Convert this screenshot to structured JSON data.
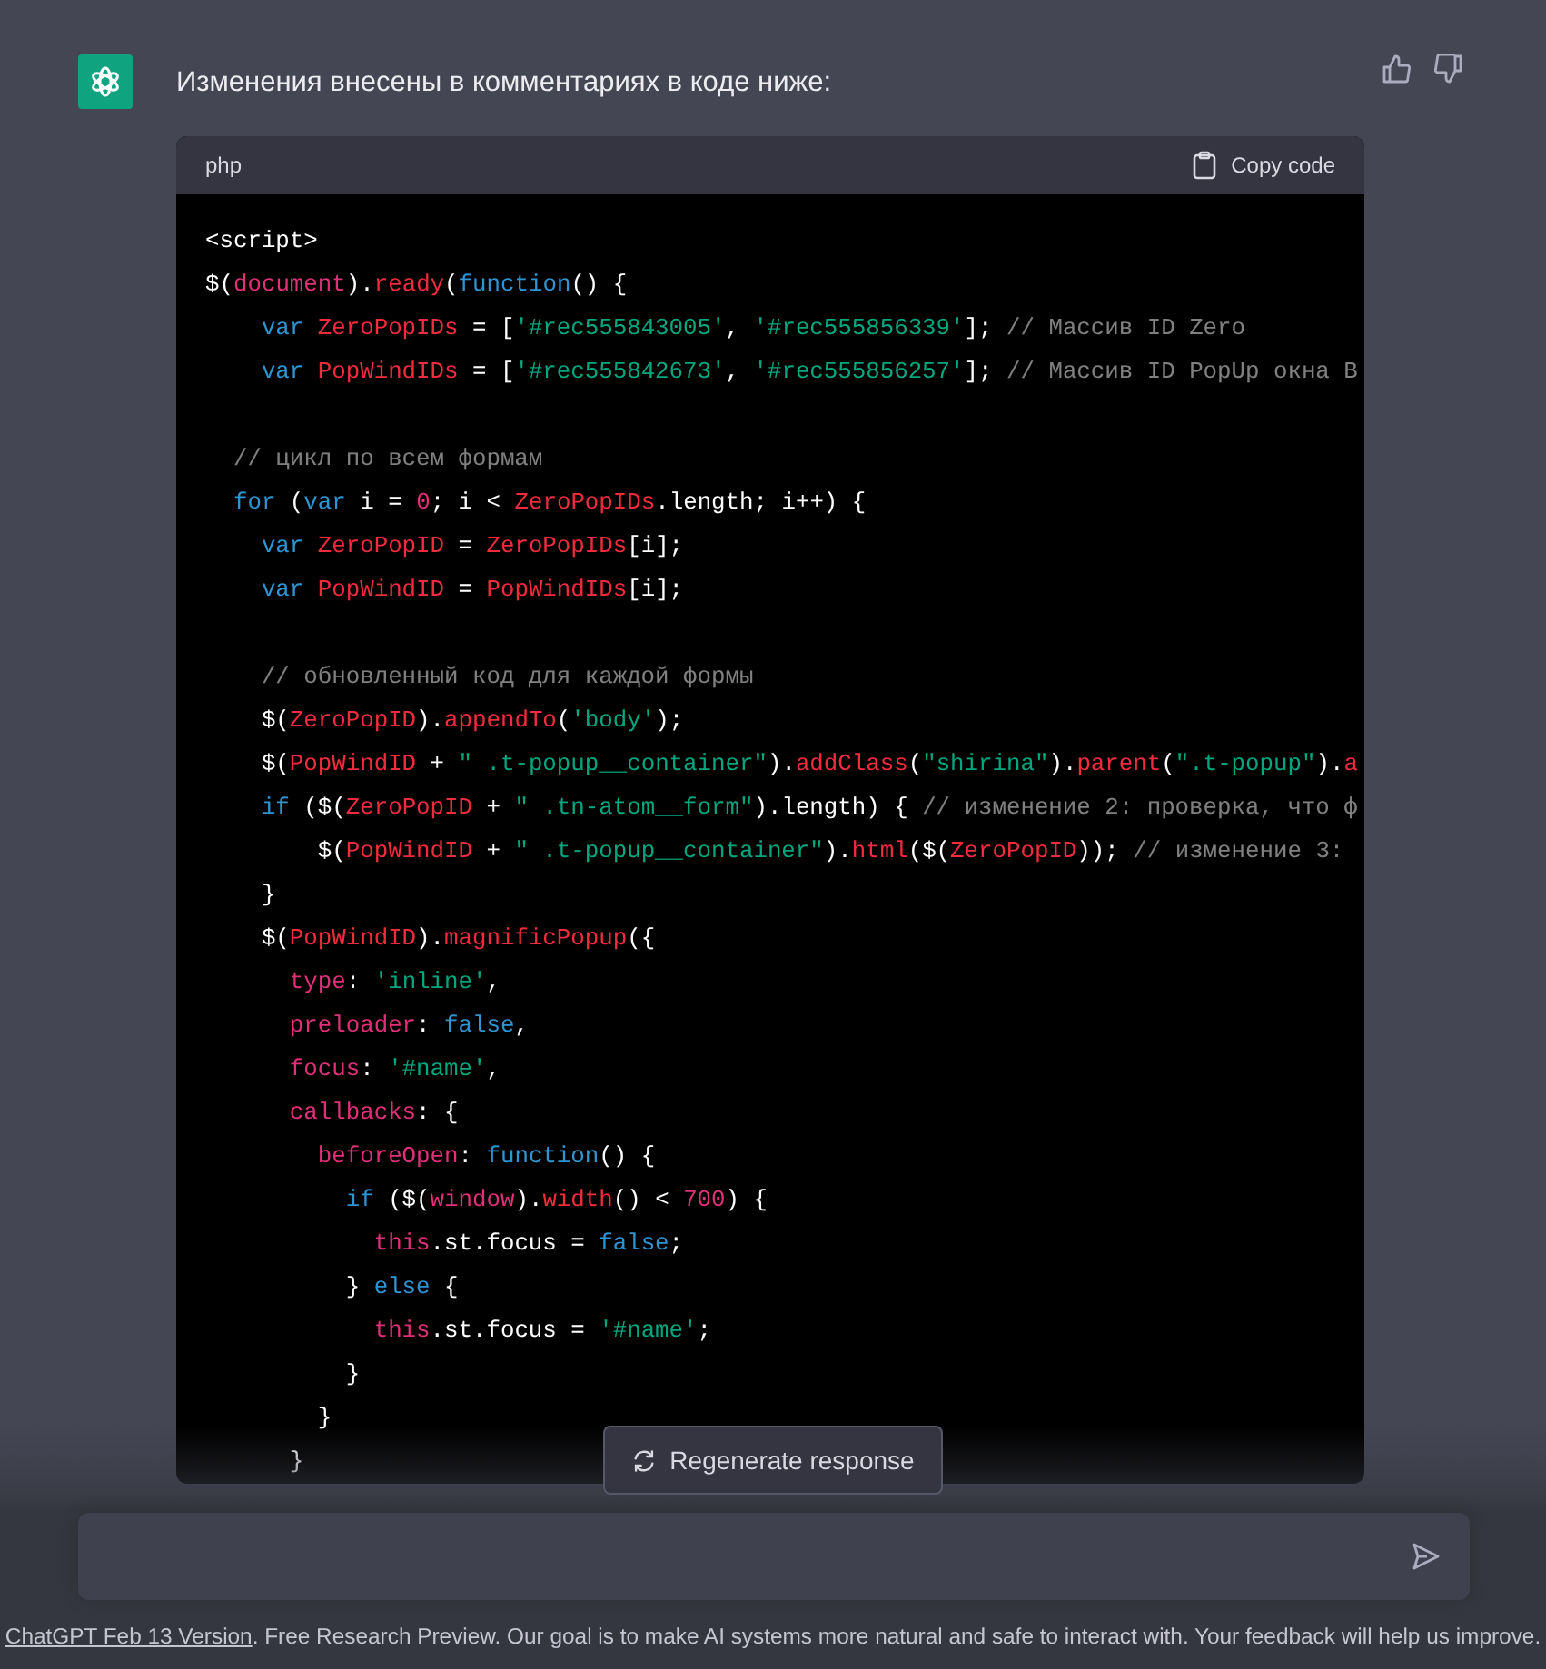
{
  "message": {
    "text": "Изменения внесены в комментариях в коде ниже:"
  },
  "code_block": {
    "language": "php",
    "copy_label": "Copy code",
    "lines": [
      {
        "kind": "code",
        "tokens": [
          {
            "kind": "plain",
            "text": "<script>"
          }
        ]
      },
      {
        "kind": "code",
        "tokens": [
          {
            "kind": "plain",
            "text": "$("
          },
          {
            "kind": "prop",
            "text": "document"
          },
          {
            "kind": "plain",
            "text": ")."
          },
          {
            "kind": "name",
            "text": "ready"
          },
          {
            "kind": "plain",
            "text": "("
          },
          {
            "kind": "keyword",
            "text": "function"
          },
          {
            "kind": "plain",
            "text": "() {"
          }
        ]
      },
      {
        "kind": "code",
        "tokens": [
          {
            "kind": "keyword",
            "text": "    var "
          },
          {
            "kind": "name",
            "text": "ZeroPopIDs"
          },
          {
            "kind": "plain",
            "text": " = ["
          },
          {
            "kind": "string",
            "text": "'#rec555843005'"
          },
          {
            "kind": "plain",
            "text": ", "
          },
          {
            "kind": "string",
            "text": "'#rec555856339'"
          },
          {
            "kind": "plain",
            "text": "]; "
          },
          {
            "kind": "comment",
            "text": "// Массив ID Zero"
          }
        ]
      },
      {
        "kind": "code",
        "tokens": [
          {
            "kind": "keyword",
            "text": "    var "
          },
          {
            "kind": "name",
            "text": "PopWindIDs"
          },
          {
            "kind": "plain",
            "text": " = ["
          },
          {
            "kind": "string",
            "text": "'#rec555842673'"
          },
          {
            "kind": "plain",
            "text": ", "
          },
          {
            "kind": "string",
            "text": "'#rec555856257'"
          },
          {
            "kind": "plain",
            "text": "]; "
          },
          {
            "kind": "comment",
            "text": "// Массив ID PopUp окна B"
          }
        ]
      },
      {
        "kind": "blank"
      },
      {
        "kind": "code",
        "tokens": [
          {
            "kind": "comment",
            "text": "  // цикл по всем формам"
          }
        ]
      },
      {
        "kind": "code",
        "tokens": [
          {
            "kind": "keyword",
            "text": "  for"
          },
          {
            "kind": "plain",
            "text": " ("
          },
          {
            "kind": "keyword",
            "text": "var"
          },
          {
            "kind": "plain",
            "text": " i = "
          },
          {
            "kind": "number",
            "text": "0"
          },
          {
            "kind": "plain",
            "text": "; i < "
          },
          {
            "kind": "name",
            "text": "ZeroPopIDs"
          },
          {
            "kind": "plain",
            "text": ".length; i++) {"
          }
        ]
      },
      {
        "kind": "code",
        "tokens": [
          {
            "kind": "keyword",
            "text": "    var "
          },
          {
            "kind": "name",
            "text": "ZeroPopID"
          },
          {
            "kind": "plain",
            "text": " = "
          },
          {
            "kind": "name",
            "text": "ZeroPopIDs"
          },
          {
            "kind": "plain",
            "text": "[i];"
          }
        ]
      },
      {
        "kind": "code",
        "tokens": [
          {
            "kind": "keyword",
            "text": "    var "
          },
          {
            "kind": "name",
            "text": "PopWindID"
          },
          {
            "kind": "plain",
            "text": " = "
          },
          {
            "kind": "name",
            "text": "PopWindIDs"
          },
          {
            "kind": "plain",
            "text": "[i];"
          }
        ]
      },
      {
        "kind": "blank"
      },
      {
        "kind": "code",
        "tokens": [
          {
            "kind": "comment",
            "text": "    // обновленный код для каждой формы"
          }
        ]
      },
      {
        "kind": "code",
        "tokens": [
          {
            "kind": "plain",
            "text": "    $("
          },
          {
            "kind": "name",
            "text": "ZeroPopID"
          },
          {
            "kind": "plain",
            "text": ")."
          },
          {
            "kind": "name",
            "text": "appendTo"
          },
          {
            "kind": "plain",
            "text": "("
          },
          {
            "kind": "string",
            "text": "'body'"
          },
          {
            "kind": "plain",
            "text": ");"
          }
        ]
      },
      {
        "kind": "code",
        "tokens": [
          {
            "kind": "plain",
            "text": "    $("
          },
          {
            "kind": "name",
            "text": "PopWindID"
          },
          {
            "kind": "plain",
            "text": " + "
          },
          {
            "kind": "string",
            "text": "\" .t-popup__container\""
          },
          {
            "kind": "plain",
            "text": ")."
          },
          {
            "kind": "name",
            "text": "addClass"
          },
          {
            "kind": "plain",
            "text": "("
          },
          {
            "kind": "string",
            "text": "\"shirina\""
          },
          {
            "kind": "plain",
            "text": ")."
          },
          {
            "kind": "name",
            "text": "parent"
          },
          {
            "kind": "plain",
            "text": "("
          },
          {
            "kind": "string",
            "text": "\".t-popup\""
          },
          {
            "kind": "plain",
            "text": ")."
          },
          {
            "kind": "name",
            "text": "a"
          }
        ]
      },
      {
        "kind": "code",
        "tokens": [
          {
            "kind": "keyword",
            "text": "    if"
          },
          {
            "kind": "plain",
            "text": " ($("
          },
          {
            "kind": "name",
            "text": "ZeroPopID"
          },
          {
            "kind": "plain",
            "text": " + "
          },
          {
            "kind": "string",
            "text": "\" .tn-atom__form\""
          },
          {
            "kind": "plain",
            "text": ").length) { "
          },
          {
            "kind": "comment",
            "text": "// изменение 2: проверка, что ф"
          }
        ]
      },
      {
        "kind": "code",
        "tokens": [
          {
            "kind": "plain",
            "text": "        $("
          },
          {
            "kind": "name",
            "text": "PopWindID"
          },
          {
            "kind": "plain",
            "text": " + "
          },
          {
            "kind": "string",
            "text": "\" .t-popup__container\""
          },
          {
            "kind": "plain",
            "text": ")."
          },
          {
            "kind": "name",
            "text": "html"
          },
          {
            "kind": "plain",
            "text": "($("
          },
          {
            "kind": "name",
            "text": "ZeroPopID"
          },
          {
            "kind": "plain",
            "text": ")); "
          },
          {
            "kind": "comment",
            "text": "// изменение 3:"
          }
        ]
      },
      {
        "kind": "code",
        "tokens": [
          {
            "kind": "plain",
            "text": "    }"
          }
        ]
      },
      {
        "kind": "code",
        "tokens": [
          {
            "kind": "plain",
            "text": "    $("
          },
          {
            "kind": "name",
            "text": "PopWindID"
          },
          {
            "kind": "plain",
            "text": ")."
          },
          {
            "kind": "name",
            "text": "magnificPopup"
          },
          {
            "kind": "plain",
            "text": "({"
          }
        ]
      },
      {
        "kind": "code",
        "tokens": [
          {
            "kind": "prop",
            "text": "      type"
          },
          {
            "kind": "plain",
            "text": ": "
          },
          {
            "kind": "string",
            "text": "'inline'"
          },
          {
            "kind": "plain",
            "text": ","
          }
        ]
      },
      {
        "kind": "code",
        "tokens": [
          {
            "kind": "prop",
            "text": "      preloader"
          },
          {
            "kind": "plain",
            "text": ": "
          },
          {
            "kind": "keyword",
            "text": "false"
          },
          {
            "kind": "plain",
            "text": ","
          }
        ]
      },
      {
        "kind": "code",
        "tokens": [
          {
            "kind": "prop",
            "text": "      focus"
          },
          {
            "kind": "plain",
            "text": ": "
          },
          {
            "kind": "string",
            "text": "'#name'"
          },
          {
            "kind": "plain",
            "text": ","
          }
        ]
      },
      {
        "kind": "code",
        "tokens": [
          {
            "kind": "prop",
            "text": "      callbacks"
          },
          {
            "kind": "plain",
            "text": ": {"
          }
        ]
      },
      {
        "kind": "code",
        "tokens": [
          {
            "kind": "prop",
            "text": "        beforeOpen"
          },
          {
            "kind": "plain",
            "text": ": "
          },
          {
            "kind": "keyword",
            "text": "function"
          },
          {
            "kind": "plain",
            "text": "() {"
          }
        ]
      },
      {
        "kind": "code",
        "tokens": [
          {
            "kind": "keyword",
            "text": "          if"
          },
          {
            "kind": "plain",
            "text": " ($("
          },
          {
            "kind": "prop",
            "text": "window"
          },
          {
            "kind": "plain",
            "text": ")."
          },
          {
            "kind": "name",
            "text": "width"
          },
          {
            "kind": "plain",
            "text": "() < "
          },
          {
            "kind": "number",
            "text": "700"
          },
          {
            "kind": "plain",
            "text": ") {"
          }
        ]
      },
      {
        "kind": "code",
        "tokens": [
          {
            "kind": "prop",
            "text": "            this"
          },
          {
            "kind": "plain",
            "text": ".st.focus = "
          },
          {
            "kind": "keyword",
            "text": "false"
          },
          {
            "kind": "plain",
            "text": ";"
          }
        ]
      },
      {
        "kind": "code",
        "tokens": [
          {
            "kind": "plain",
            "text": "          } "
          },
          {
            "kind": "keyword",
            "text": "else"
          },
          {
            "kind": "plain",
            "text": " {"
          }
        ]
      },
      {
        "kind": "code",
        "tokens": [
          {
            "kind": "prop",
            "text": "            this"
          },
          {
            "kind": "plain",
            "text": ".st.focus = "
          },
          {
            "kind": "string",
            "text": "'#name'"
          },
          {
            "kind": "plain",
            "text": ";"
          }
        ]
      },
      {
        "kind": "code",
        "tokens": [
          {
            "kind": "plain",
            "text": "          }"
          }
        ]
      },
      {
        "kind": "code",
        "tokens": [
          {
            "kind": "plain",
            "text": "        }"
          }
        ]
      },
      {
        "kind": "code",
        "tokens": [
          {
            "kind": "plain",
            "text": "      }"
          }
        ]
      }
    ]
  },
  "regenerate_button": "Regenerate response",
  "footer": {
    "link": "ChatGPT Feb 13 Version",
    "text": ". Free Research Preview. Our goal is to make AI systems more natural and safe to interact with. Your feedback will help us improve."
  }
}
